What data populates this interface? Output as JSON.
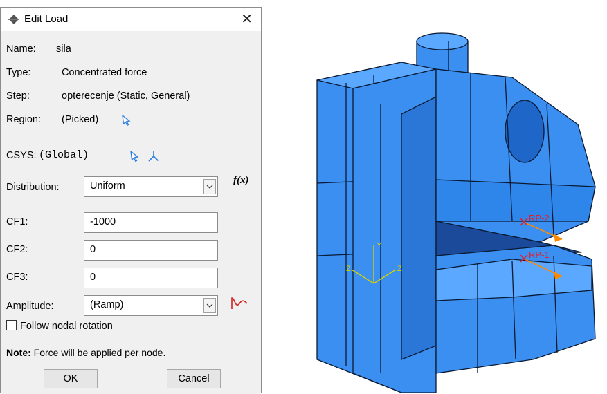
{
  "dialog": {
    "title": "Edit Load",
    "close_glyph": "✕",
    "name_label": "Name:",
    "name_value": "sila",
    "type_label": "Type:",
    "type_value": "Concentrated force",
    "step_label": "Step:",
    "step_value": "opterecenje (Static, General)",
    "region_label": "Region:",
    "region_value": "(Picked)",
    "csys_label": "CSYS:",
    "csys_value": "(Global)",
    "distribution_label": "Distribution:",
    "distribution_value": "Uniform",
    "fx_label": "f(x)",
    "cf1_label": "CF1:",
    "cf1_value": "-1000",
    "cf2_label": "CF2:",
    "cf2_value": "0",
    "cf3_label": "CF3:",
    "cf3_value": "0",
    "amplitude_label": "Amplitude:",
    "amplitude_value": "(Ramp)",
    "follow_label": "Follow nodal rotation",
    "note_label": "Note:",
    "note_text": "Force will be applied per node.",
    "ok_label": "OK",
    "cancel_label": "Cancel"
  },
  "viewport": {
    "rp2_label": "RP-2",
    "rp1_label": "RP-1",
    "triad_y": "Y",
    "triad_z": "Z",
    "triad_x": "Z"
  },
  "colors": {
    "model_fill": "#3a8ff0",
    "model_edge": "#0b1a33",
    "load_arrow": "#ff8a00",
    "rp_marker": "#e0202a",
    "triad": "#d8d000"
  }
}
